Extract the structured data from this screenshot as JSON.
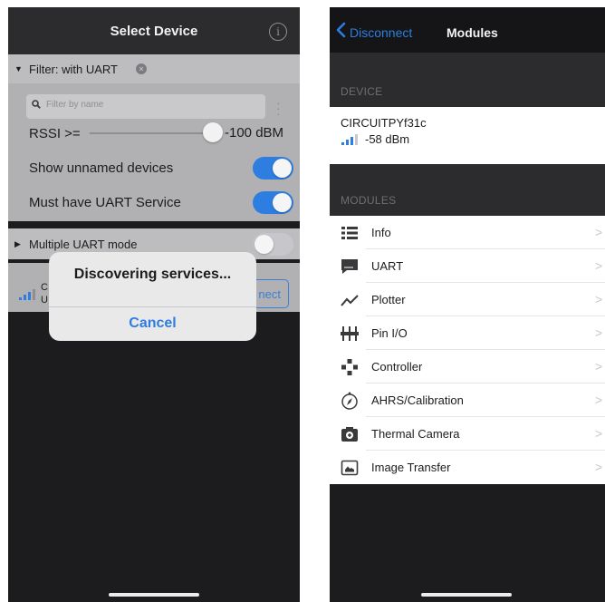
{
  "left": {
    "nav_title": "Select Device",
    "filter": {
      "title": "Filter: with UART",
      "search_placeholder": "Filter by name",
      "rssi_label": "RSSI >=",
      "rssi_value": "-100 dBM",
      "rssi_slider_fraction": 0.98,
      "show_unnamed_label": "Show unnamed devices",
      "show_unnamed_on": true,
      "must_have_uart_label": "Must have UART Service",
      "must_have_uart_on": true
    },
    "multiple_uart": {
      "label": "Multiple UART mode",
      "on": false
    },
    "device_row": {
      "name_partial": "C\nU",
      "connect_label": "nect"
    },
    "alert": {
      "title": "Discovering services...",
      "cancel_label": "Cancel"
    }
  },
  "right": {
    "back_label": "Disconnect",
    "nav_title": "Modules",
    "device_section": "DEVICE",
    "device_name": "CIRCUITPYf31c",
    "device_rssi": "-58 dBm",
    "modules_section": "MODULES",
    "modules": [
      {
        "label": "Info",
        "icon": "list-icon"
      },
      {
        "label": "UART",
        "icon": "chat-icon"
      },
      {
        "label": "Plotter",
        "icon": "plot-line-icon"
      },
      {
        "label": "Pin I/O",
        "icon": "pins-icon"
      },
      {
        "label": "Controller",
        "icon": "dpad-icon"
      },
      {
        "label": "AHRS/Calibration",
        "icon": "compass-icon"
      },
      {
        "label": "Thermal Camera",
        "icon": "camera-icon"
      },
      {
        "label": "Image Transfer",
        "icon": "image-icon"
      }
    ]
  },
  "colors": {
    "accent_blue": "#2d7ee0",
    "dark_bg": "#1c1c1e",
    "filter_grey": "#b1b1b4"
  }
}
